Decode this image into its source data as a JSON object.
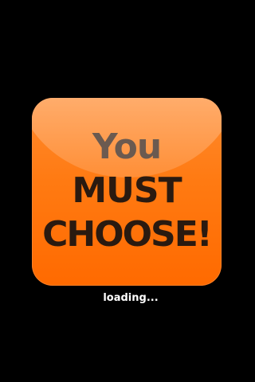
{
  "splash": {
    "line1": "You",
    "line2": "MUST",
    "line3": "CHOOSE!"
  },
  "status": {
    "loading_text": "loading..."
  },
  "colors": {
    "background": "#000000",
    "icon_orange": "#ff7a12",
    "text_dark": "#2a1a10",
    "text_gray": "#6b5a50",
    "loading_text": "#ffffff"
  }
}
